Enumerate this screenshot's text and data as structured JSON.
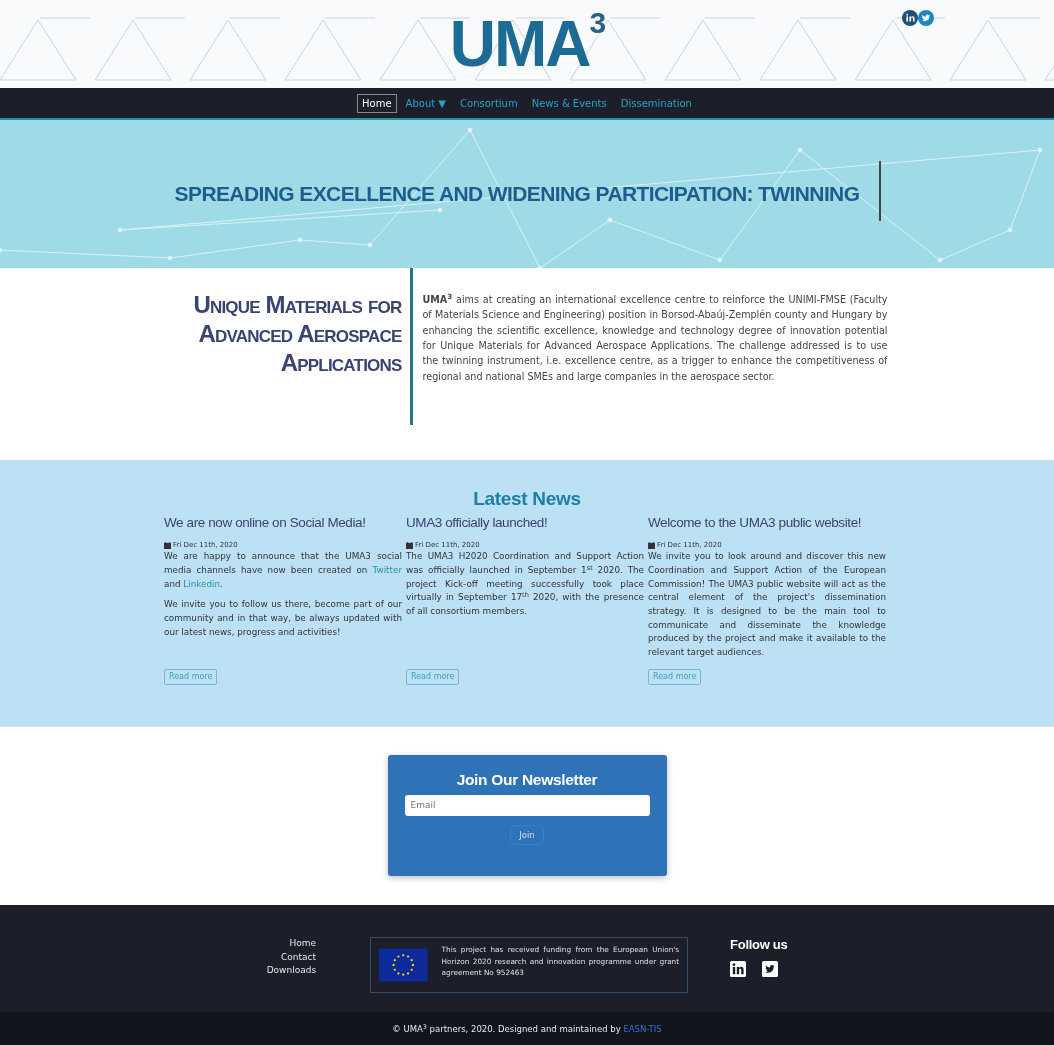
{
  "header": {
    "logo": "UMA$^{3}$",
    "social": [
      {
        "kind": "linkedin"
      },
      {
        "kind": "twitter"
      }
    ]
  },
  "nav": [
    {
      "label": "Home",
      "selected": true
    },
    {
      "label": "About",
      "selected": false,
      "caret": "▼"
    },
    {
      "label": "Consortium",
      "selected": false
    },
    {
      "label": "News & Events",
      "selected": false
    },
    {
      "label": "Dissemination",
      "selected": false
    }
  ],
  "hero": {
    "title": "SPREADING EXCELLENCE AND WIDENING PARTICIPATION: TWINNING"
  },
  "intro": {
    "heading": "Unique Materials for Advanced Aerospace Applications",
    "text": "**UMA$^{3}$** aims at creating an international excellence centre to reinforce the UNIMI-FMSE (Faculty of Materials Science and Engineering) position in Borsod-Abaúj-Zemplén county and Hungary by enhancing the scientific excellence, knowledge and technology degree of innovation potential for Unique Materials for Advanced Aerospace Applications. The challenge addressed is to use the twinning instrument, i.e. excellence centre, as a trigger to enhance the competitiveness of regional and national SMEs and large companies in the aerospace sector."
  },
  "news": {
    "title": "Latest News",
    "items": [
      {
        "title": "We are now online on Social Media!",
        "date": "Fri Dec 11th, 2020",
        "paragraphs": [
          [
            {
              "text": "We are happy to announce that the UMA3 social media channels have now been created on "
            },
            {
              "link": "Twitter"
            },
            {
              "text": " and "
            },
            {
              "link": "Linkedin"
            },
            {
              "text": "."
            }
          ],
          [
            {
              "text": "We invite you to follow us there, become part of our community and in that way, be always updated with our latest news, progress and activities!"
            }
          ]
        ],
        "button": "Read more"
      },
      {
        "title": "UMA3 officially launched!",
        "date": "Fri Dec 11th, 2020",
        "paragraphs": [
          [
            {
              "text": "The UMA3 H2020 Coordination and Support Action was officially launched in September 1$^{st}$ 2020. The project Kick-off meeting successfully took place virtually in September 17$^{th}$ 2020, with the presence of all consortium members."
            }
          ]
        ],
        "button": "Read more"
      },
      {
        "title": "Welcome to the UMA3 public website!",
        "date": "Fri Dec 11th, 2020",
        "paragraphs": [
          [
            {
              "text": "We invite you to look around and discover this new Coordination and Support Action of the European Commission! The UMA3 public website will act as the central element of the project's dissemination strategy. It is designed to be the main tool to communicate and disseminate the knowledge produced by the project and make it available to the relevant target audiences."
            }
          ]
        ],
        "button": "Read more"
      }
    ]
  },
  "newsletter": {
    "title": "Join Our Newsletter",
    "placeholder": "Email",
    "button": "Join"
  },
  "footer": {
    "links": [
      "Home",
      "Contact",
      "Downloads"
    ],
    "funding": "This project has received funding from the European Union's Horizon 2020 research and innovation programme under grant agreement No 952463",
    "follow_title": "Follow us",
    "social": [
      {
        "kind": "linkedin"
      },
      {
        "kind": "twitter"
      }
    ]
  },
  "copyright": {
    "text": "© UMA$^{3}$ partners, 2020. Designed and maintained by ",
    "link": "EASN-TIS"
  }
}
